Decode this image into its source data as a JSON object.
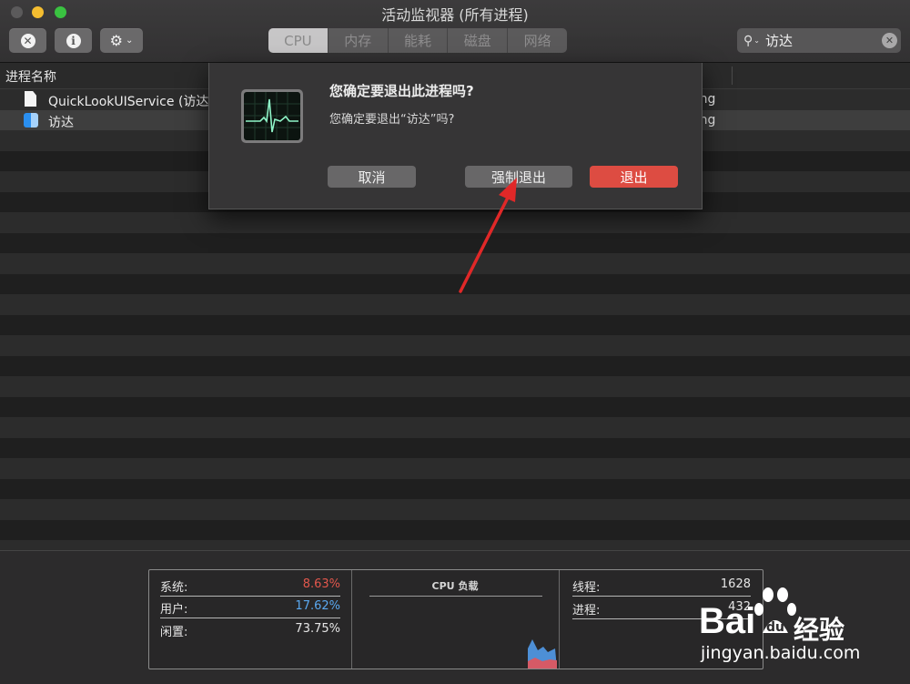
{
  "window": {
    "title": "活动监视器 (所有进程)"
  },
  "toolbar": {
    "stop_icon": "x-circle-icon",
    "info_icon": "info-circle-icon",
    "gear_icon": "gear-icon",
    "tabs": [
      {
        "label": "CPU",
        "active": true
      },
      {
        "label": "内存",
        "active": false
      },
      {
        "label": "能耗",
        "active": false
      },
      {
        "label": "磁盘",
        "active": false
      },
      {
        "label": "网络",
        "active": false
      }
    ],
    "search": {
      "value": "访达",
      "icon": "search-icon"
    }
  },
  "table": {
    "column_process_name": "进程名称",
    "rows": [
      {
        "name": "QuickLookUIService (访达)",
        "user": "ang",
        "icon": "document-icon"
      },
      {
        "name": "访达",
        "user": "ang",
        "icon": "finder-icon",
        "selected": true
      }
    ]
  },
  "dialog": {
    "title": "您确定要退出此进程吗?",
    "message": "您确定要退出“访达”吗?",
    "cancel": "取消",
    "force_quit": "强制退出",
    "quit": "退出"
  },
  "cpu_panel": {
    "system_label": "系统:",
    "system_value": "8.63%",
    "user_label": "用户:",
    "user_value": "17.62%",
    "idle_label": "闲置:",
    "idle_value": "73.75%",
    "graph_title": "CPU 负载",
    "threads_label": "线程:",
    "threads_value": "1628",
    "processes_label": "进程:",
    "processes_value": "432"
  },
  "colors": {
    "system": "#e2574c",
    "user": "#5aa8f0",
    "quit_button": "#dd4c42"
  },
  "watermark": {
    "brand": "Bai",
    "brand2": "经验",
    "url": "jingyan.baidu.com"
  }
}
